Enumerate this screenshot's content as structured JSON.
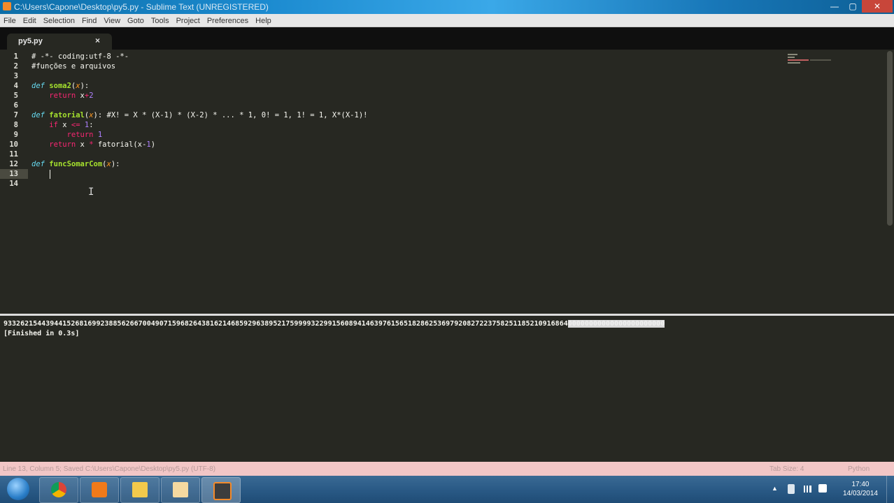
{
  "window": {
    "title": "C:\\Users\\Capone\\Desktop\\py5.py - Sublime Text (UNREGISTERED)",
    "minimize": "—",
    "maximize": "▢",
    "close": "✕"
  },
  "menu": [
    "File",
    "Edit",
    "Selection",
    "Find",
    "View",
    "Goto",
    "Tools",
    "Project",
    "Preferences",
    "Help"
  ],
  "tab": {
    "label": "py5.py",
    "close": "×"
  },
  "editor": {
    "line_numbers": [
      "1",
      "2",
      "3",
      "4",
      "5",
      "6",
      "7",
      "8",
      "9",
      "10",
      "11",
      "12",
      "13",
      "14"
    ],
    "current_line": 13,
    "lines": [
      "# -*- coding:utf-8 -*-",
      "#funções e arquivos",
      "",
      "def soma2(x):",
      "    return x+2",
      "",
      "def fatorial(x): #X! = X * (X-1) * (X-2) * ... * 1, 0! = 1, 1! = 1, X*(X-1)!",
      "    if x <= 1:",
      "        return 1",
      "    return x * fatorial(x-1)",
      "",
      "def funcSomarCom(x):",
      "    ",
      ""
    ],
    "ibeam": "I"
  },
  "output": {
    "result_digits": "93326215443944152681699238856266700490715968264381621468592963895217599993229915608941463976156518286253697920827223758251185210916864",
    "result_selected": "00000000000000000000000",
    "finished": "[Finished in 0.3s]"
  },
  "status": {
    "left": "Line 13, Column 5; Saved C:\\Users\\Capone\\Desktop\\py5.py (UTF-8)",
    "tab_size": "Tab Size: 4",
    "syntax": "Python"
  },
  "taskbar": {
    "apps": [
      "chrome-icon",
      "media-player-icon",
      "explorer-folder-icon",
      "paint-icon",
      "sublime-text-icon"
    ],
    "clock_time": "17:40",
    "clock_date": "14/03/2014",
    "tray_arrow": "▲"
  },
  "colors": {
    "editor_bg": "#272822",
    "keyword": "#66d9ef",
    "function": "#a6e22e",
    "argument": "#fd971f",
    "operator": "#f92672",
    "number": "#ae81ff",
    "status_bg": "#f2c6c6"
  }
}
